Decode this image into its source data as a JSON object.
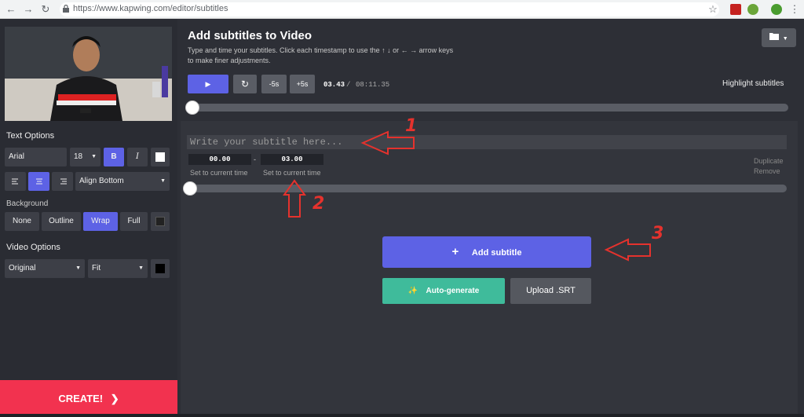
{
  "browser": {
    "url": "https://www.kapwing.com/editor/subtitles"
  },
  "sidebar": {
    "text_options_title": "Text Options",
    "font": "Arial",
    "font_size": "18",
    "bold_label": "B",
    "italic_label": "I",
    "align_label": "Align Bottom",
    "background_title": "Background",
    "bg_none": "None",
    "bg_outline": "Outline",
    "bg_wrap": "Wrap",
    "bg_full": "Full",
    "video_options_title": "Video Options",
    "video_size": "Original",
    "video_fit": "Fit",
    "create_label": "CREATE!",
    "colors": {
      "text_swatch": "#ffffff",
      "bg_swatch": "#222222",
      "video_swatch": "#000000",
      "accent": "#5d62e5",
      "create": "#f2324f"
    }
  },
  "main": {
    "title": "Add subtitles to Video",
    "instructions": "Type and time your subtitles. Click each timestamp to use the ↑ ↓ or ← → arrow keys to make finer adjustments.",
    "back5": "-5s",
    "fwd5": "+5s",
    "current_time": "03.43",
    "separator": "/",
    "total_time": "08:11.35",
    "highlight_label": "Highlight subtitles",
    "subtitle_placeholder": "Write your subtitle here...",
    "start_time": "00.00",
    "dash": "-",
    "end_time": "03.00",
    "set_start_label": "Set to current time",
    "set_end_label": "Set to current time",
    "duplicate_label": "Duplicate",
    "remove_label": "Remove",
    "add_subtitle_label": "Add subtitle",
    "auto_generate_label": "Auto-generate",
    "upload_srt_label": "Upload .SRT"
  },
  "annotations": {
    "n1": "1",
    "n2": "2",
    "n3": "3",
    "color": "#e5322d"
  }
}
